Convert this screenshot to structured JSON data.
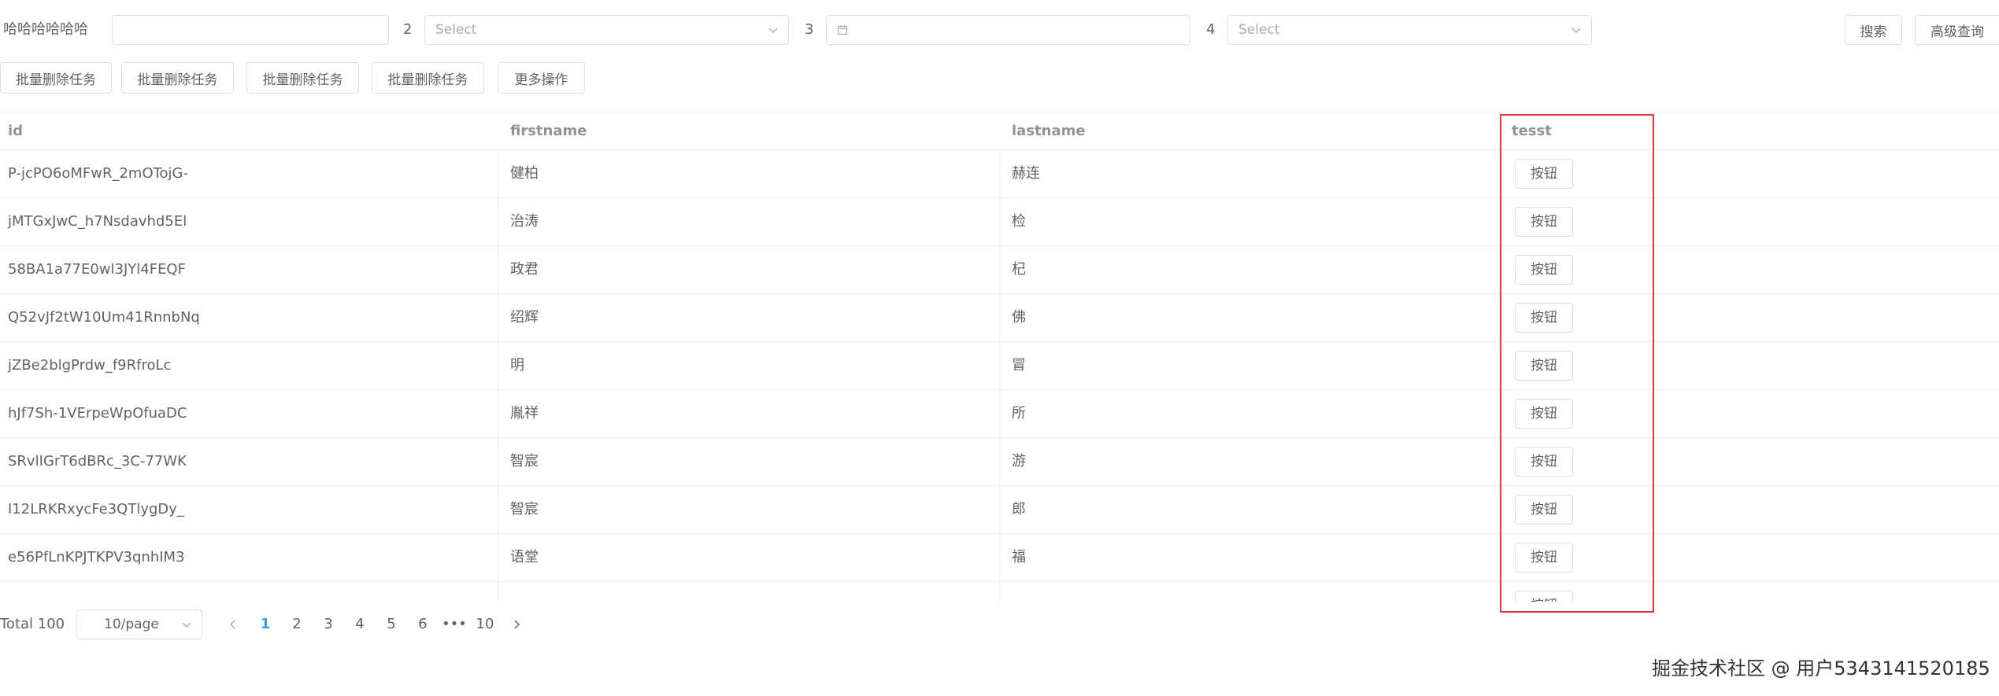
{
  "search": {
    "label1": "哈哈哈哈哈哈",
    "input1_value": "",
    "label2": "2",
    "select2_placeholder": "Select",
    "label3": "3",
    "date_value": "",
    "label4": "4",
    "select4_placeholder": "Select",
    "search_button": "搜索",
    "advanced_button": "高级查询"
  },
  "toolbar": {
    "buttons": [
      "批量删除任务",
      "批量删除任务",
      "批量删除任务",
      "批量删除任务",
      "更多操作"
    ]
  },
  "table": {
    "columns": [
      "id",
      "firstname",
      "lastname",
      "tesst"
    ],
    "row_button_label": "按钮",
    "rows": [
      {
        "id": "P-jcPO6oMFwR_2mOTojG-",
        "firstname": "健柏",
        "lastname": "赫连"
      },
      {
        "id": "jMTGxJwC_h7Nsdavhd5El",
        "firstname": "治涛",
        "lastname": "检"
      },
      {
        "id": "58BA1a77E0wl3JYl4FEQF",
        "firstname": "政君",
        "lastname": "杞"
      },
      {
        "id": "Q52vJf2tW10Um41RnnbNq",
        "firstname": "绍辉",
        "lastname": "佛"
      },
      {
        "id": "jZBe2blgPrdw_f9RfroLc",
        "firstname": "明",
        "lastname": "冒"
      },
      {
        "id": "hJf7Sh-1VErpeWpOfuaDC",
        "firstname": "胤祥",
        "lastname": "所"
      },
      {
        "id": "SRvlIGrT6dBRc_3C-77WK",
        "firstname": "智宸",
        "lastname": "游"
      },
      {
        "id": "I12LRKRxycFe3QTlygDy_",
        "firstname": "智宸",
        "lastname": "郎"
      },
      {
        "id": "e56PfLnKPJTKPV3qnhIM3",
        "firstname": "语堂",
        "lastname": "福"
      }
    ]
  },
  "pagination": {
    "total": "Total 100",
    "page_size": "10/page",
    "pages": [
      "1",
      "2",
      "3",
      "4",
      "5",
      "6"
    ],
    "ellipsis": "•••",
    "last_page": "10",
    "current_page": "1"
  },
  "watermark": "掘金技术社区 @ 用户5343141520185",
  "colors": {
    "accent": "#409eff",
    "highlight_border": "#d9363e",
    "border": "#dcdfe6",
    "header_text": "#909399"
  }
}
